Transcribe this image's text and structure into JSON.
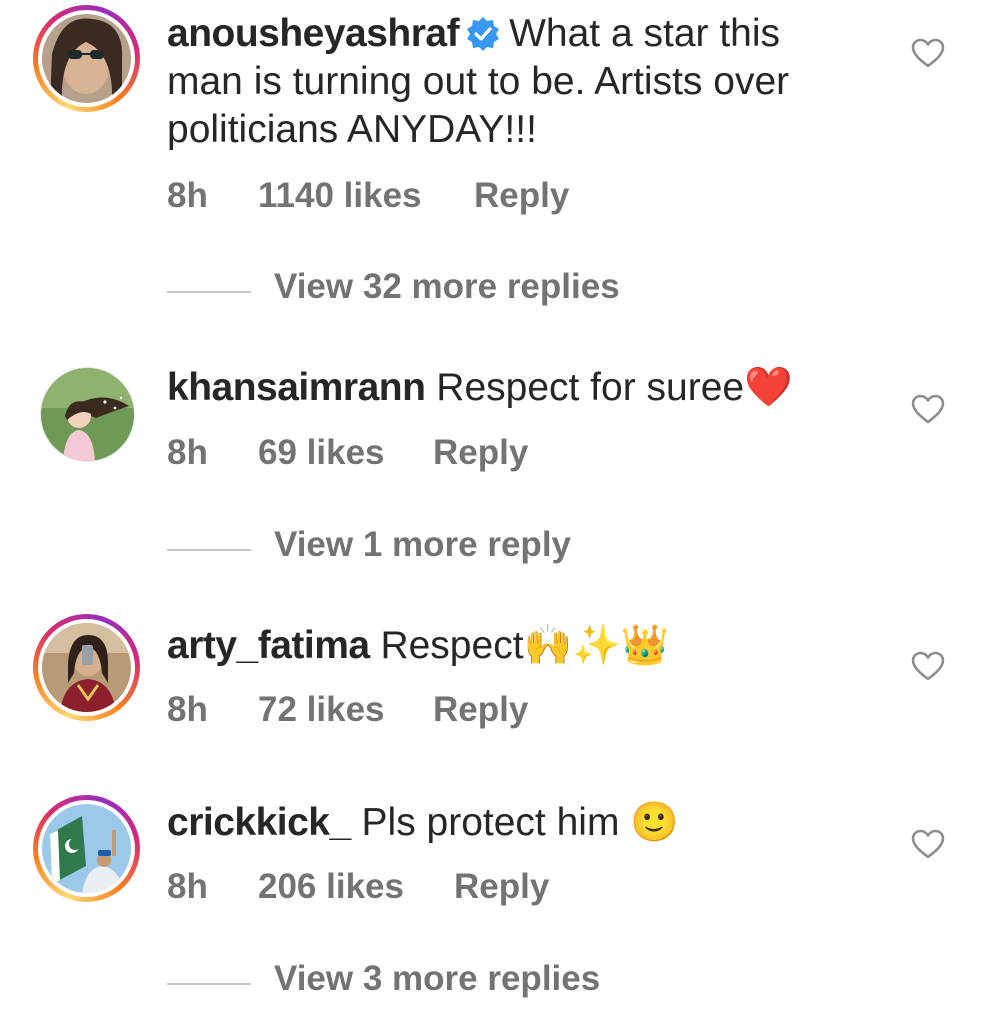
{
  "comments": [
    {
      "username": "anousheyashraf",
      "verified": true,
      "text_lines": [
        "What a star this",
        "man is turning out to be. Artists over",
        "politicians ANYDAY!!!"
      ],
      "time": "8h",
      "likes": "1140 likes",
      "reply_label": "Reply",
      "view_more": "View 32 more replies",
      "avatar_ring": true
    },
    {
      "username": "khansaimrann",
      "text": "Respect for suree",
      "emoji": "❤️",
      "time": "8h",
      "likes": "69 likes",
      "reply_label": "Reply",
      "view_more": "View 1 more reply",
      "avatar_ring": false
    },
    {
      "username": "arty_fatima",
      "text": "Respect",
      "emoji": "🙌✨👑",
      "time": "8h",
      "likes": "72 likes",
      "reply_label": "Reply",
      "avatar_ring": true
    },
    {
      "username": "crickkick_",
      "text": "Pls protect him",
      "emoji": "🙂",
      "time": "8h",
      "likes": "206 likes",
      "reply_label": "Reply",
      "view_more": "View 3 more replies",
      "avatar_ring": true
    }
  ],
  "icons": {
    "like": "heart-outline-icon",
    "verified": "verified-badge-icon"
  },
  "colors": {
    "verified_blue": "#3897f0",
    "meta_gray": "#737373",
    "text": "#262626"
  }
}
